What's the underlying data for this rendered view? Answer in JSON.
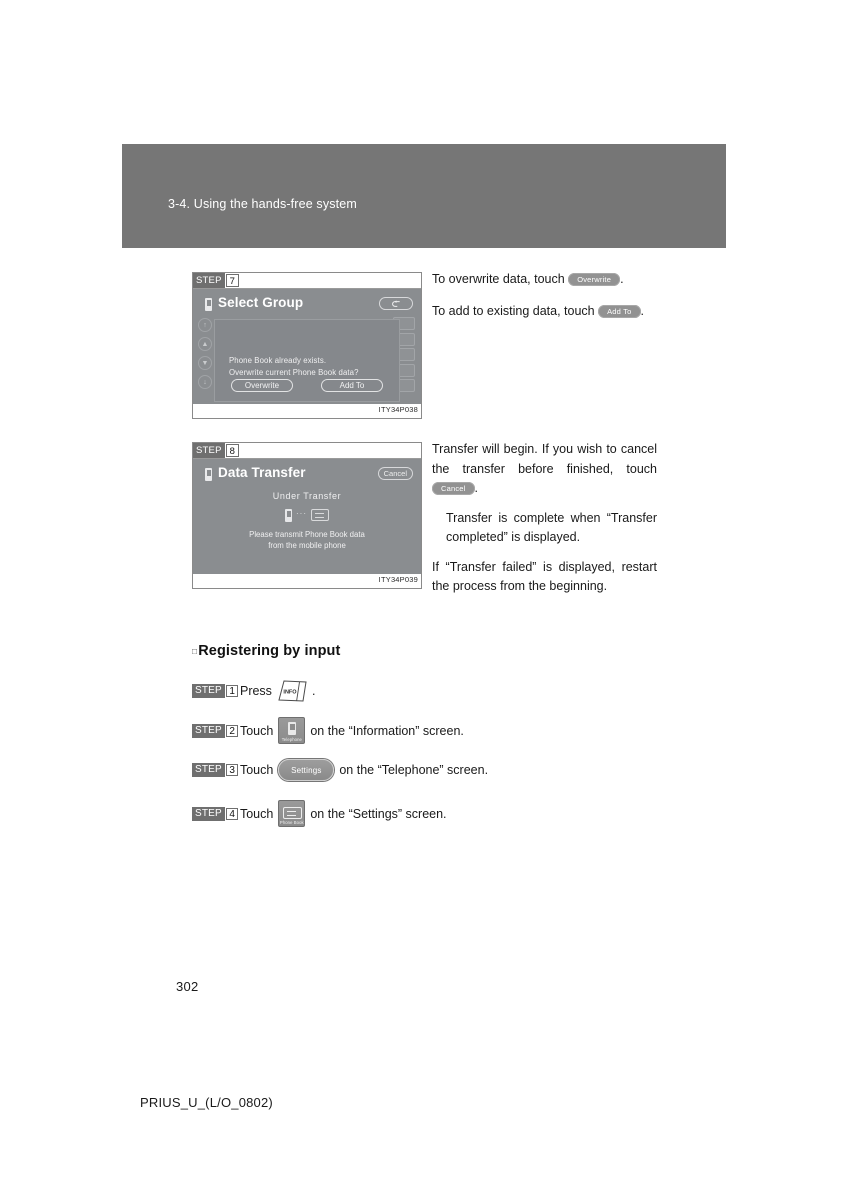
{
  "header": {
    "section_title": "3-4. Using the hands-free system"
  },
  "figures": [
    {
      "step_word": "STEP",
      "step_number": "7",
      "caption_code": "ITY34P038",
      "screen": {
        "title": "Select Group",
        "topright_button": "return-arrow",
        "dialog_lines": [
          "Phone Book already exists.",
          "Overwrite current Phone Book data?"
        ],
        "dialog_buttons": [
          "Overwrite",
          "Add To"
        ],
        "scroll_buttons": [
          "↑",
          "▲",
          "▼",
          "↓"
        ]
      }
    },
    {
      "step_word": "STEP",
      "step_number": "8",
      "caption_code": "ITY34P039",
      "screen": {
        "title": "Data Transfer",
        "topright_button": "Cancel",
        "status_text": "Under Transfer",
        "message_lines": [
          "Please transmit Phone Book data",
          "from the mobile phone"
        ]
      }
    }
  ],
  "right_column": {
    "block1": {
      "line1_before": "To overwrite data, touch",
      "pill1": "Overwrite",
      "line1_after": ".",
      "line2_before": "To add to existing data, touch",
      "pill2": "Add To",
      "line2_after": "."
    },
    "block2": {
      "p1_before": "Transfer will begin. If you wish to cancel the transfer before finished, touch",
      "p1_pill": "Cancel",
      "p1_after": ".",
      "p2": "Transfer is complete when “Transfer completed” is displayed.",
      "p3": "If “Transfer failed” is displayed, restart the process from the beginning."
    }
  },
  "section": {
    "bullet": "□",
    "heading": "Registering by input",
    "steps": [
      {
        "word": "STEP",
        "number": "1",
        "verb": "Press",
        "control": "INFO",
        "control_type": "info-key",
        "suffix": "."
      },
      {
        "word": "STEP",
        "number": "2",
        "verb": "Touch",
        "control": "Telephone",
        "control_type": "icon-phone",
        "suffix": "on the “Information” screen."
      },
      {
        "word": "STEP",
        "number": "3",
        "verb": "Touch",
        "control": "Settings",
        "control_type": "pill",
        "suffix": "on the “Telephone” screen."
      },
      {
        "word": "STEP",
        "number": "4",
        "verb": "Touch",
        "control": "Phone Book",
        "control_type": "icon-book",
        "suffix": "on the “Settings” screen."
      }
    ]
  },
  "footer": {
    "page_number": "302",
    "code": "PRIUS_U_(L/O_0802)"
  },
  "colors": {
    "header_band": "#767676",
    "screen_bg": "#8a8d90",
    "badge_gray": "#6f6f6f",
    "pill_gray": "#929292"
  }
}
